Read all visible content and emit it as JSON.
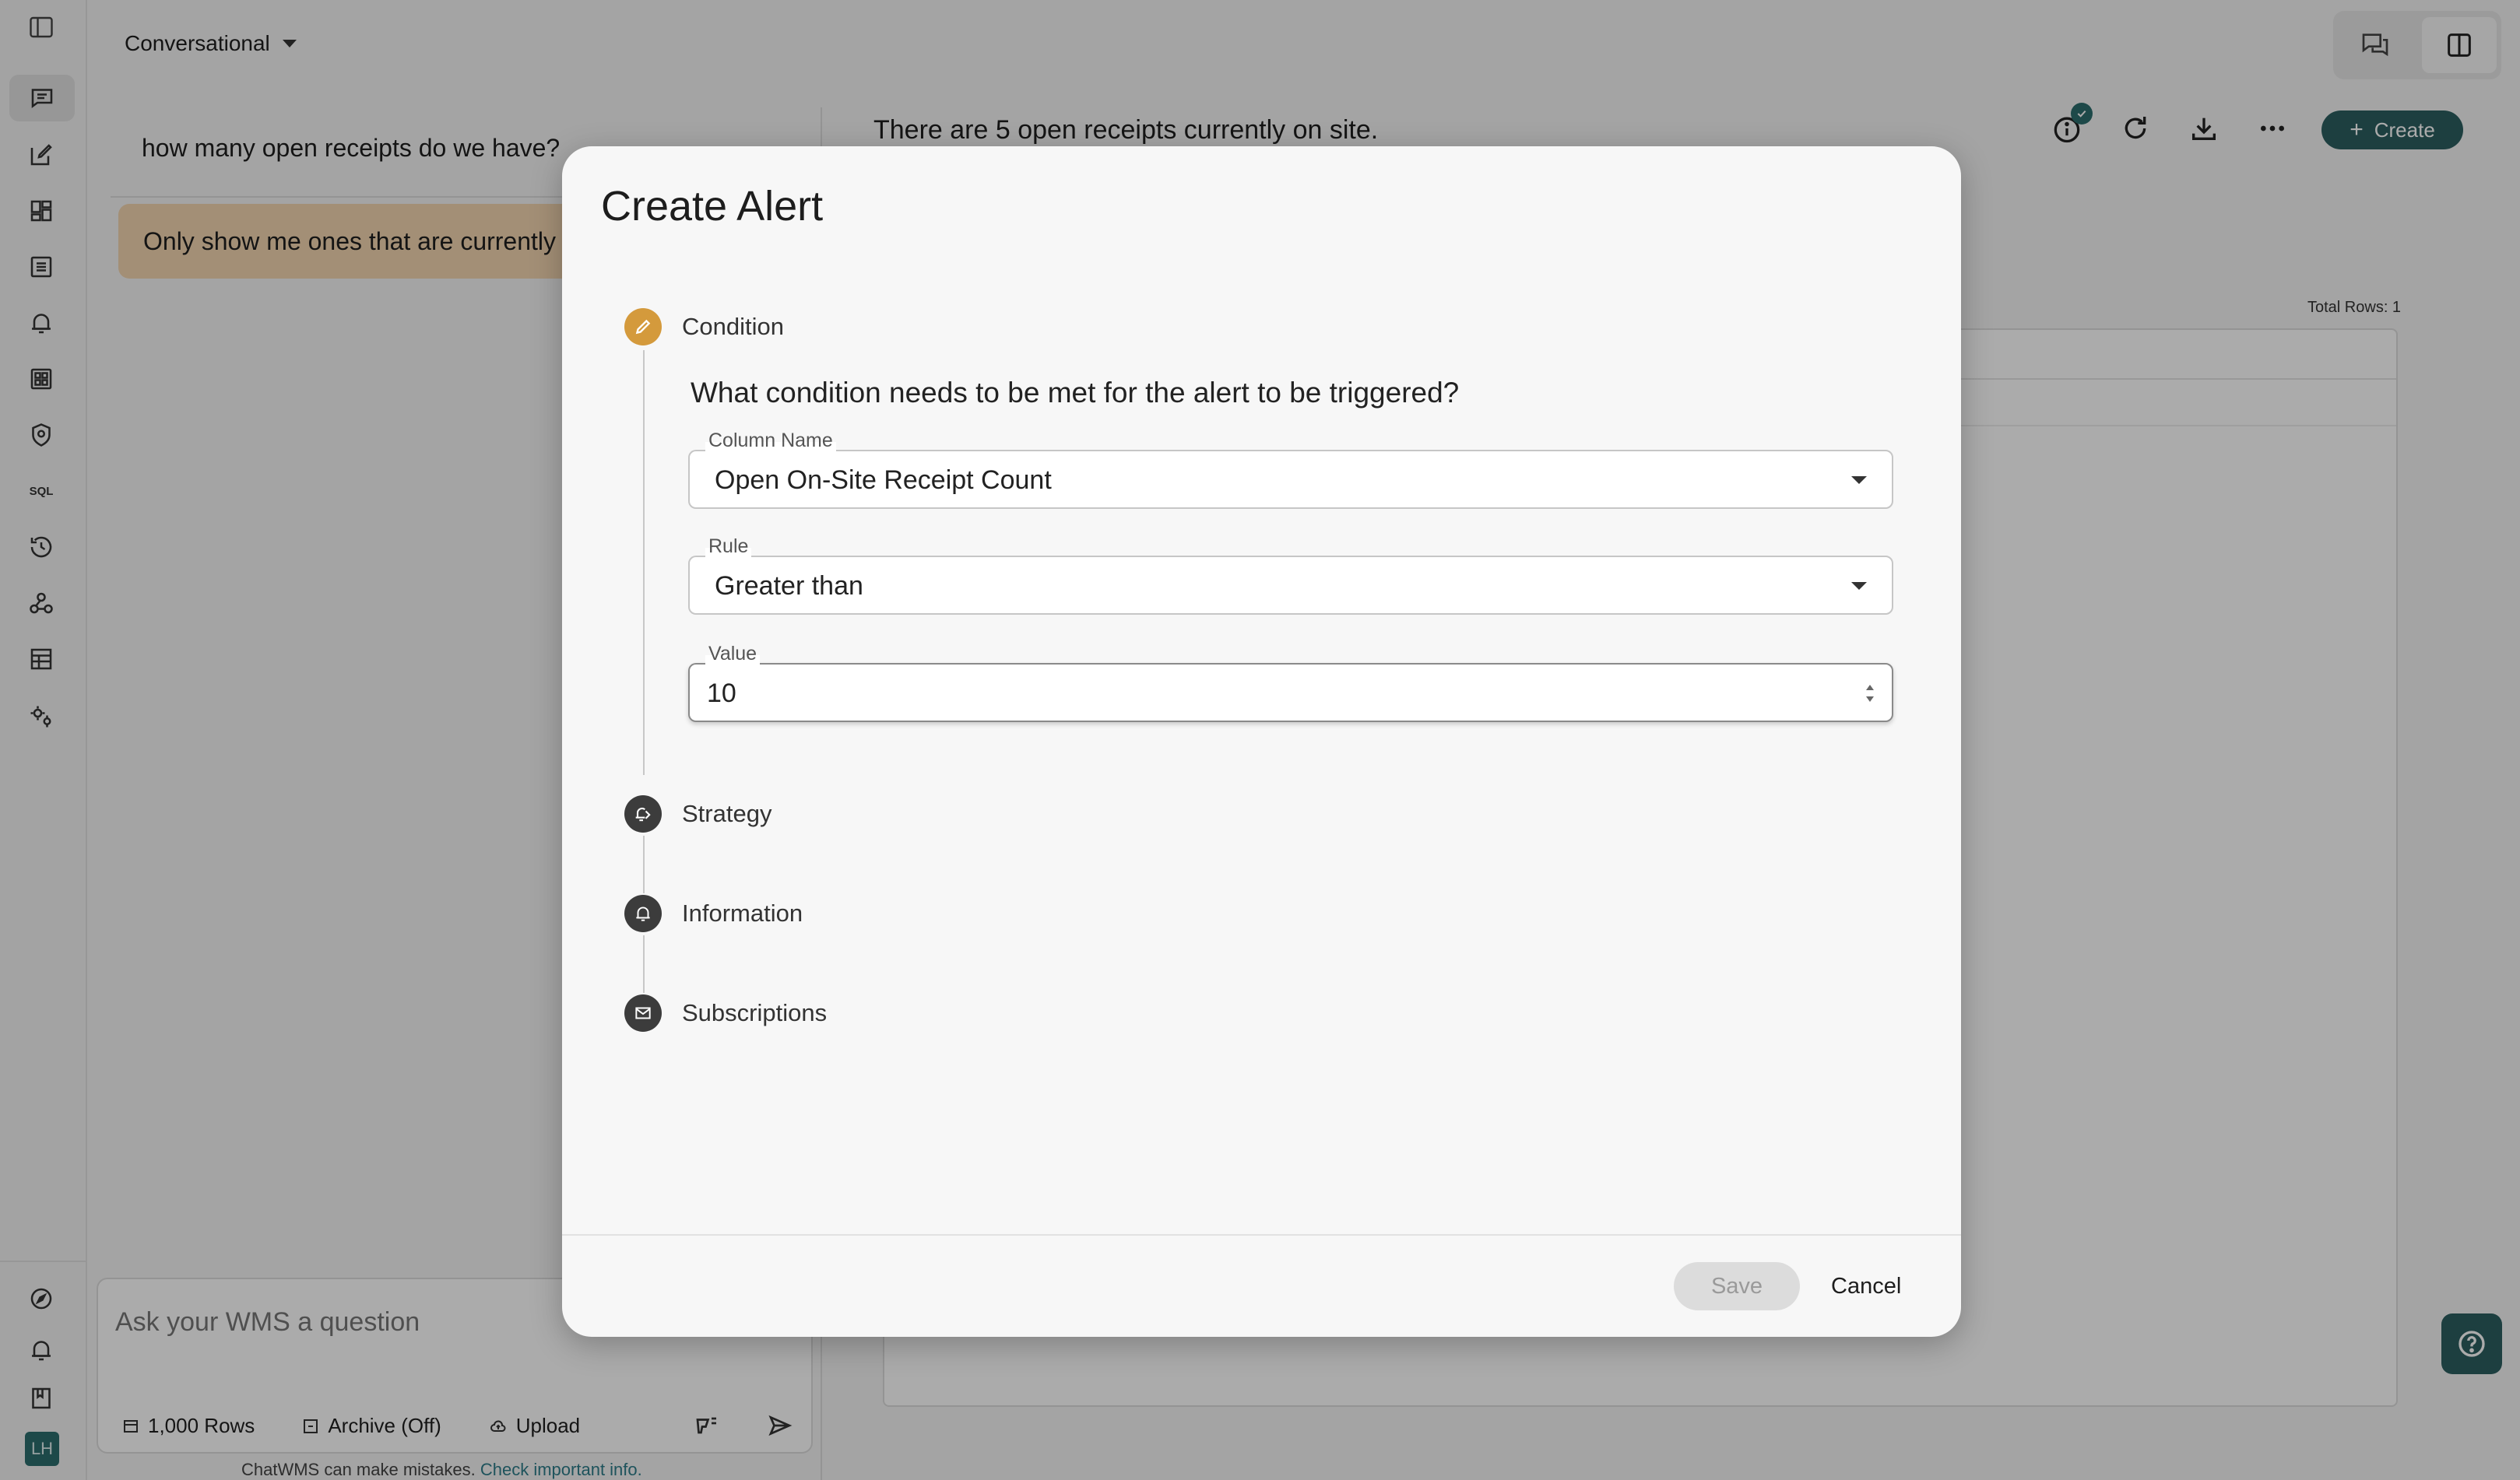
{
  "app": {
    "mode_label": "Conversational",
    "avatar_initials": "LH",
    "sql_label": "SQL"
  },
  "chat": {
    "messages": [
      "how many open receipts do we have?",
      "Only show me ones that are currently on site"
    ],
    "composer_placeholder": "Ask your WMS a question",
    "rows_label": "1,000 Rows",
    "archive_label": "Archive (Off)",
    "upload_label": "Upload",
    "disclaimer": "ChatWMS can make mistakes.",
    "disclaimer_link": "Check important info."
  },
  "result": {
    "answer": "There are 5 open receipts currently on site.",
    "create_label": "Create",
    "total_rows": "Total Rows: 1"
  },
  "dialog": {
    "title": "Create Alert",
    "steps": [
      "Condition",
      "Strategy",
      "Information",
      "Subscriptions"
    ],
    "question": "What condition needs to be met for the alert to be triggered?",
    "column_name": {
      "label": "Column Name",
      "value": "Open On-Site Receipt Count"
    },
    "rule": {
      "label": "Rule",
      "value": "Greater than"
    },
    "value_field": {
      "label": "Value",
      "value": "10"
    },
    "save_label": "Save",
    "cancel_label": "Cancel"
  },
  "colors": {
    "accent": "#2c5f60",
    "active_step": "#d49a3c",
    "user_bubble": "#f3d6b0"
  }
}
